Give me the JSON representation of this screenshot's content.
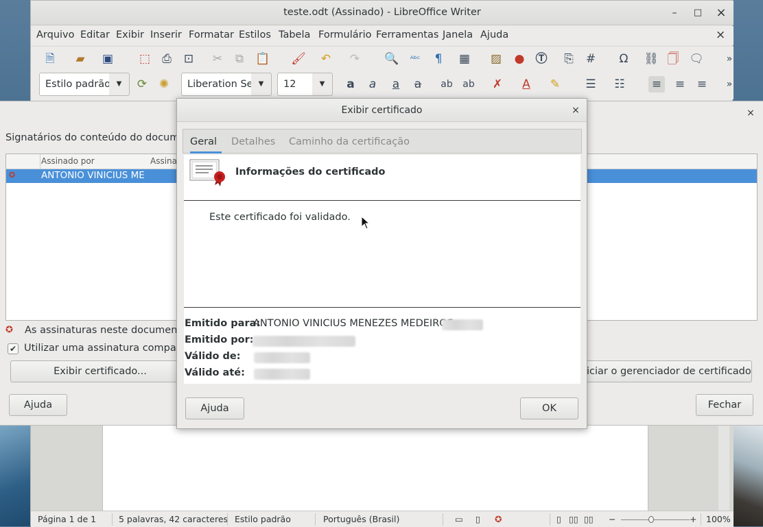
{
  "writer": {
    "title": "teste.odt (Assinado) - LibreOffice Writer",
    "window_controls": {
      "minimize": "–",
      "maximize": "□",
      "close": "×"
    },
    "menu": [
      "Arquivo",
      "Editar",
      "Exibir",
      "Inserir",
      "Formatar",
      "Estilos",
      "Tabela",
      "Formulário",
      "Ferramentas",
      "Janela",
      "Ajuda"
    ],
    "menu_close": "×",
    "paragraph_style": "Estilo padrão",
    "font_name": "Liberation Se",
    "font_size": "12",
    "overflow": "»",
    "statusbar": {
      "page": "Página 1 de 1",
      "words": "5 palavras, 42 caracteres",
      "style": "Estilo padrão",
      "language": "Português (Brasil)",
      "zoom": "100%"
    }
  },
  "signatures_dialog": {
    "close": "×",
    "heading": "Signatários do conteúdo do documen",
    "columns": [
      "Assinado por",
      "Assinat"
    ],
    "rows": [
      {
        "signed_by": "ANTONIO VINICIUS ME"
      }
    ],
    "notice": "As assinaturas neste documento s",
    "checkbox_label": "Utilizar uma assinatura compatível",
    "checkbox_checked": true,
    "view_cert_button": "Exibir certificado...",
    "manager_button": "iciar o gerenciador de certificados...",
    "help_button": "Ajuda",
    "close_button": "Fechar"
  },
  "cert_dialog": {
    "title": "Exibir certificado",
    "close": "×",
    "tabs": [
      "Geral",
      "Detalhes",
      "Caminho da certificação"
    ],
    "active_tab": "Geral",
    "info_title": "Informações do certificado",
    "validated_text": "Este certificado foi validado.",
    "fields": {
      "issued_to_label": "Emitido para:",
      "issued_to_value": "ANTONIO VINICIUS MENEZES MEDEIROS",
      "issued_by_label": "Emitido por:",
      "valid_from_label": "Válido de:",
      "valid_until_label": "Válido até:"
    },
    "help_button": "Ajuda",
    "ok_button": "OK"
  }
}
